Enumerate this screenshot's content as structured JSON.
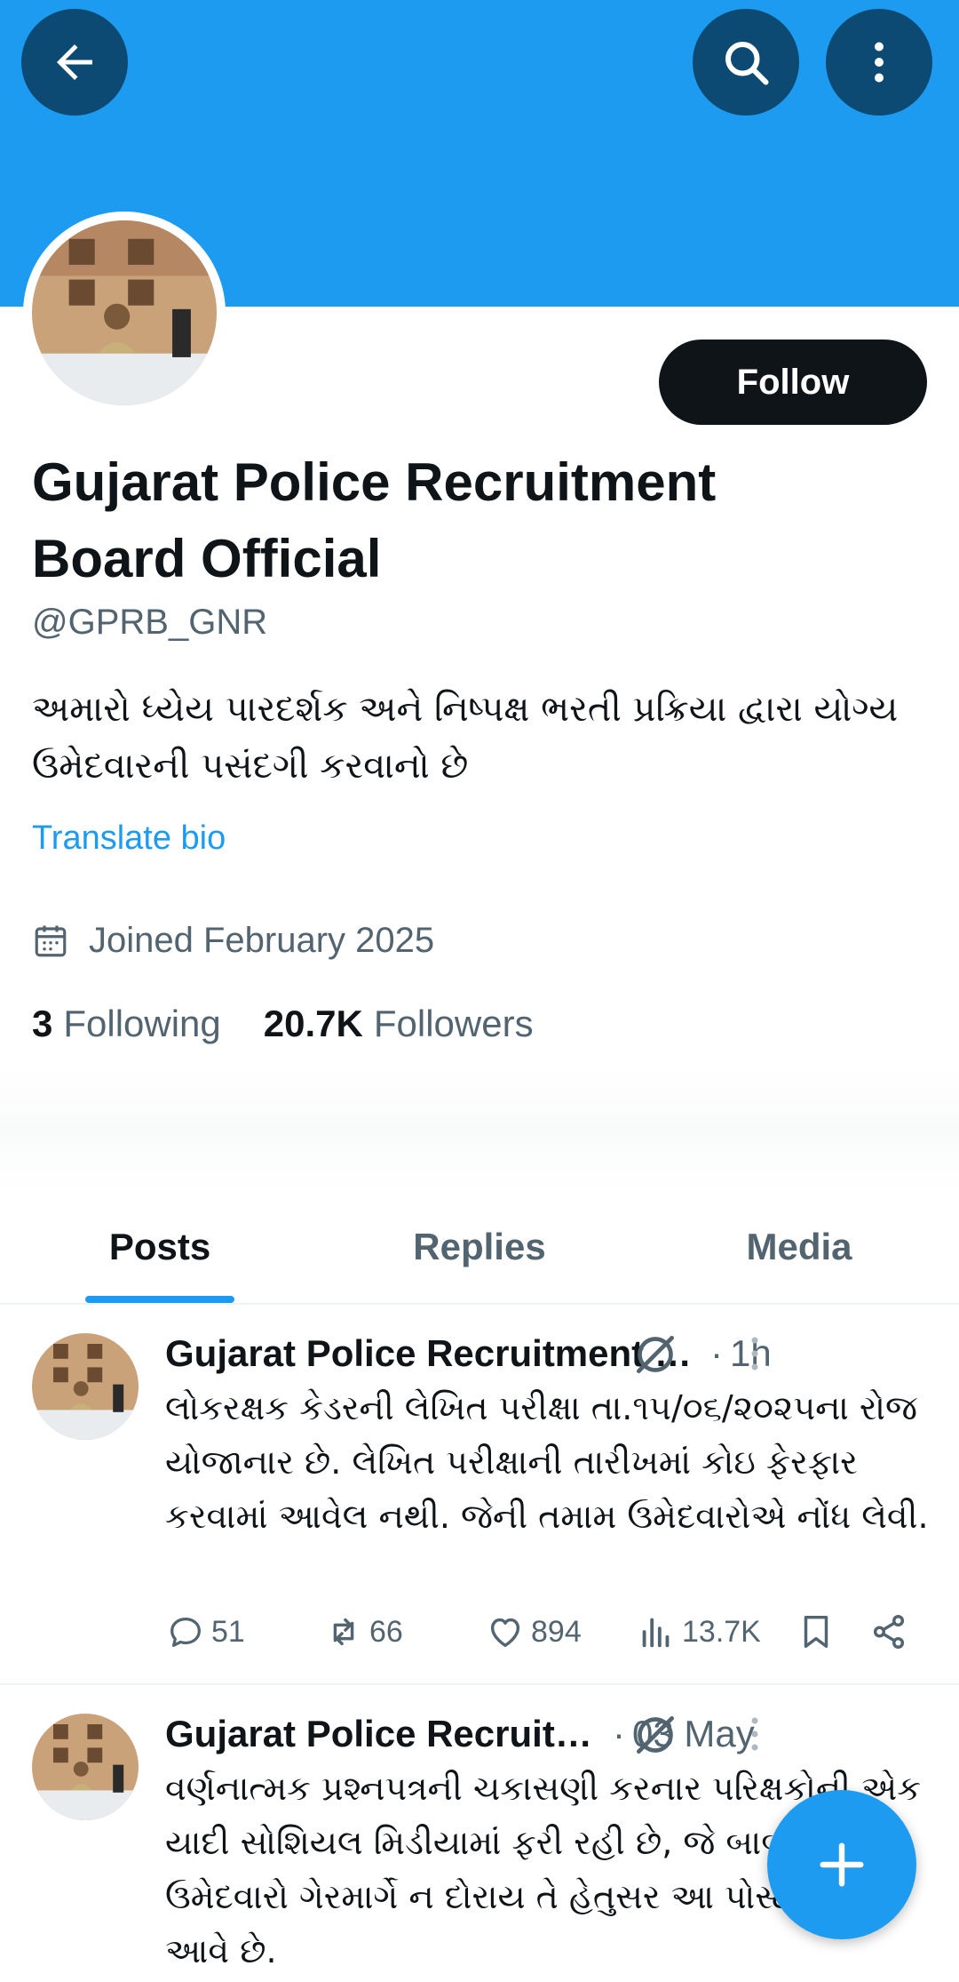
{
  "header": {
    "back_icon": "arrow-left-icon",
    "search_icon": "search-icon",
    "more_icon": "more-vertical-icon",
    "banner_color": "#1d9bf0"
  },
  "profile": {
    "follow_label": "Follow",
    "display_name": "Gujarat Police Recruitment Board Official",
    "handle": "@GPRB_GNR",
    "bio": "અમારો ધ્યેય પારદર્શક અને નિષ્પક્ષ ભરતી પ્રક્રિયા દ્વારા યોગ્ય ઉમેદવારની પસંદગી કરવાનો છે",
    "translate_label": "Translate bio",
    "joined": "Joined February 2025",
    "following_count": "3",
    "following_label": "Following",
    "followers_count": "20.7K",
    "followers_label": "Followers"
  },
  "tabs": [
    {
      "label": "Posts",
      "active": true
    },
    {
      "label": "Replies",
      "active": false
    },
    {
      "label": "Media",
      "active": false
    }
  ],
  "posts": [
    {
      "author": "Gujarat Police Recruitment Board Official",
      "time": "1h",
      "text": "લોકરક્ષક કેડરની લેખિત પરીક્ષા તા.૧૫/૦૬/૨૦૨૫ના રોજ યોજાનાર છે. લેખિત પરીક્ષાની તારીખમાં કોઇ ફેરફાર કરવામાં આવેલ નથી. જેની તમામ ઉમેદવારોએ નોંધ લેવી.",
      "replies": "51",
      "reposts": "66",
      "likes": "894",
      "views": "13.7K"
    },
    {
      "author": "Gujarat Police Recruitment Board Official",
      "time": "03 May",
      "text": "વર્ણનાત્મક પ્રશ્નપત્રની ચકાસણી કરનાર પરિક્ષકોની એક યાદી સોશિયલ મિડીયામાં ફરી રહી છે, જે બાબતે ઉમેદવારો ગેરમાર્ગે ન દોરાય તે હેતુસર આ પોસ્ટ કરવામાં આવે છે."
    }
  ],
  "fab": {
    "icon": "plus-icon"
  }
}
